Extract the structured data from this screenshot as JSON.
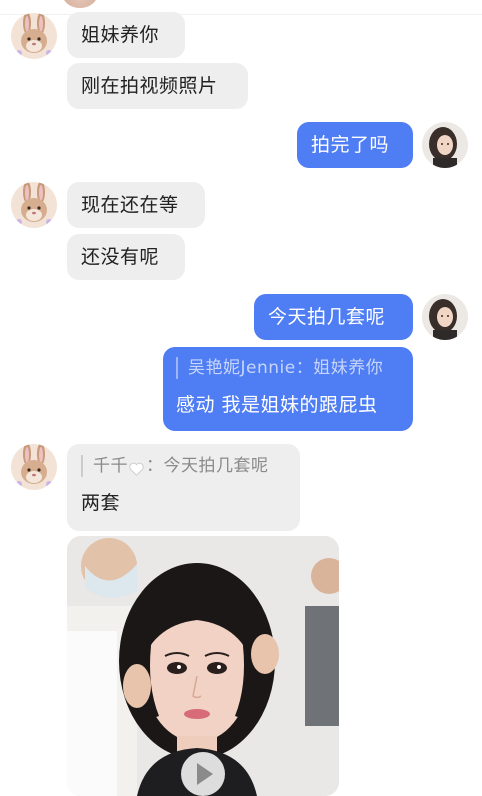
{
  "messages": [
    {
      "side": "in",
      "text": "姐妹养你"
    },
    {
      "side": "in",
      "text": "刚在拍视频照片"
    },
    {
      "side": "out",
      "text": "拍完了吗"
    },
    {
      "side": "in",
      "text": "现在还在等"
    },
    {
      "side": "in",
      "text": "还没有呢"
    },
    {
      "side": "out",
      "text": "今天拍几套呢"
    },
    {
      "side": "out",
      "quote_sender": "吴艳妮Jennie",
      "quote_sep": "：",
      "quote_text": "姐妹养你",
      "text": "感动 我是姐妹的跟屁虫"
    },
    {
      "side": "in",
      "quote_sender": "千千",
      "quote_sender_icon": "white-heart-icon",
      "quote_sep": "：",
      "quote_text": "今天拍几套呢",
      "text": "两套"
    },
    {
      "side": "in",
      "type": "video",
      "thumbnail": "woman-with-hair-being-styled",
      "icon": "play-icon"
    }
  ],
  "colors": {
    "incoming_bubble": "#eeeeee",
    "outgoing_bubble": "#4f7df3",
    "incoming_text": "#222222",
    "outgoing_text": "#ffffff",
    "quote_text_in": "#8a8a8a"
  }
}
